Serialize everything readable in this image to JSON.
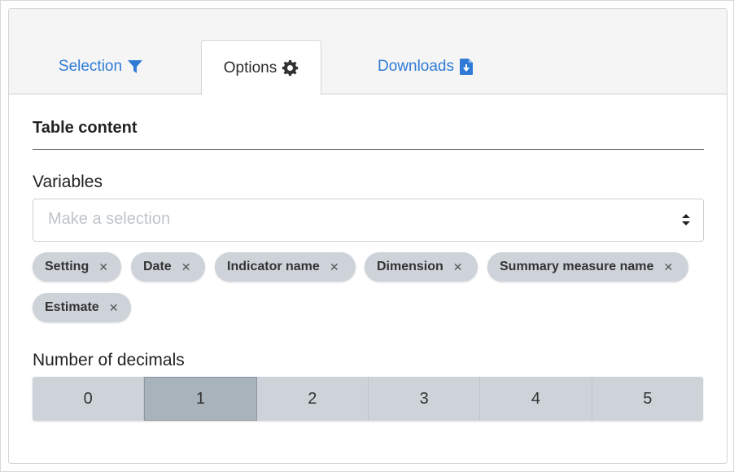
{
  "tabs": [
    {
      "label": "Selection",
      "icon": "filter-icon"
    },
    {
      "label": "Options",
      "icon": "gear-icon"
    },
    {
      "label": "Downloads",
      "icon": "file-download-icon"
    }
  ],
  "active_tab": "Options",
  "colors": {
    "link": "#2f7bd6",
    "chip_bg": "#cdd3d9",
    "segment_active": "#a9b3bc"
  },
  "table_content": {
    "title": "Table content",
    "variables": {
      "label": "Variables",
      "placeholder": "Make a selection",
      "selected": [
        "Setting",
        "Date",
        "Indicator name",
        "Dimension",
        "Summary measure name",
        "Estimate"
      ]
    },
    "decimals": {
      "label": "Number of decimals",
      "options": [
        "0",
        "1",
        "2",
        "3",
        "4",
        "5"
      ],
      "selected": "1"
    }
  }
}
